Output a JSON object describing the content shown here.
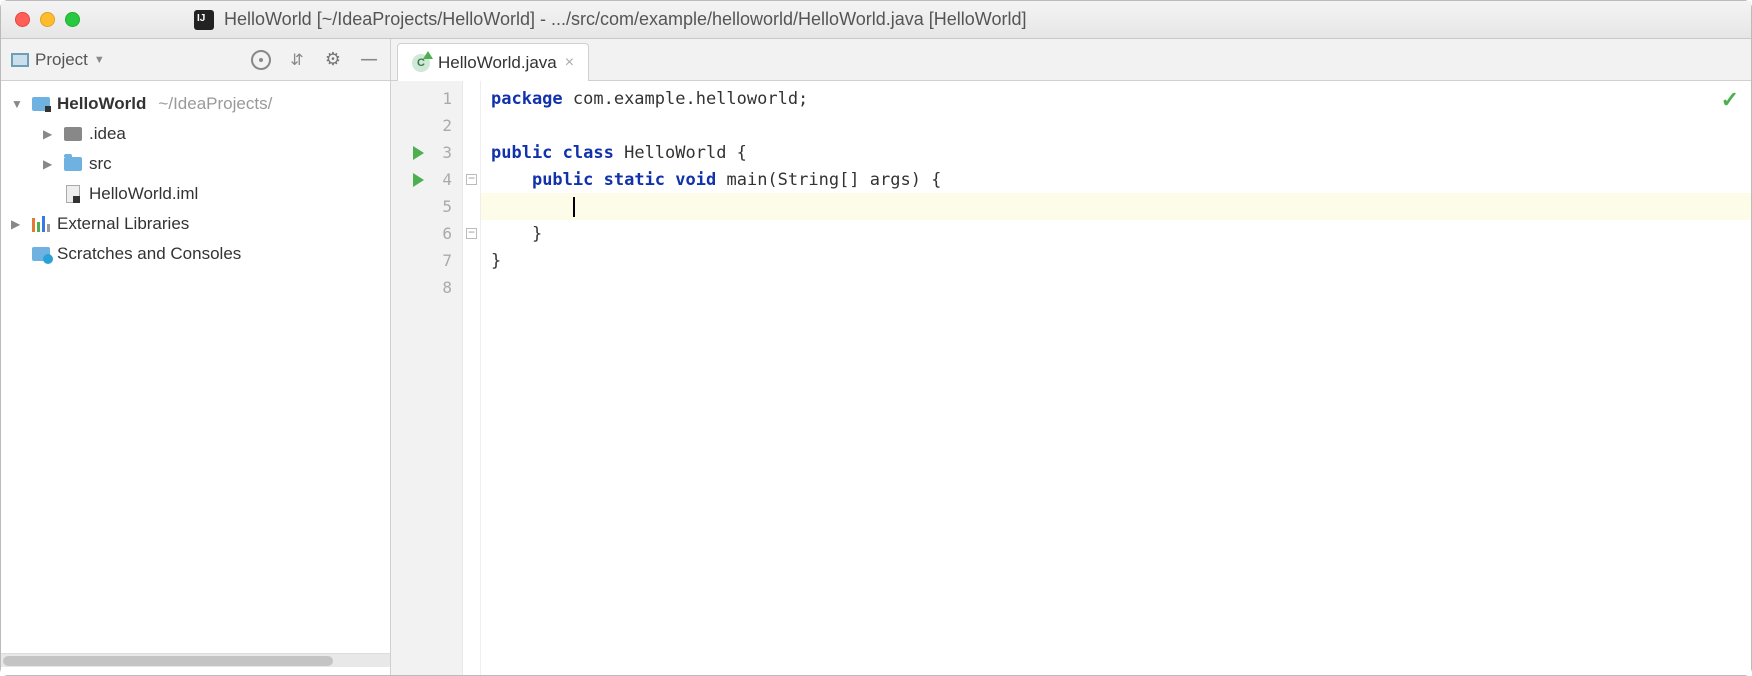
{
  "window": {
    "title": "HelloWorld [~/IdeaProjects/HelloWorld] - .../src/com/example/helloworld/HelloWorld.java [HelloWorld]"
  },
  "sidebar": {
    "tool_label": "Project",
    "tree": {
      "root": {
        "label": "HelloWorld",
        "sublabel": "~/IdeaProjects/"
      },
      "idea": {
        "label": ".idea"
      },
      "src": {
        "label": "src"
      },
      "iml": {
        "label": "HelloWorld.iml"
      },
      "ext": {
        "label": "External Libraries"
      },
      "scratch": {
        "label": "Scratches and Consoles"
      }
    }
  },
  "tabs": {
    "file": "HelloWorld.java"
  },
  "editor": {
    "gutter": [
      "1",
      "2",
      "3",
      "4",
      "5",
      "6",
      "7",
      "8"
    ],
    "code": {
      "l1a": "package",
      "l1b": " com.example.helloworld;",
      "l3a": "public",
      "l3b": " ",
      "l3c": "class",
      "l3d": " HelloWorld {",
      "l4a": "    ",
      "l4b": "public",
      "l4c": " ",
      "l4d": "static",
      "l4e": " ",
      "l4f": "void",
      "l4g": " main(String[] args) {",
      "l5a": "        ",
      "l6a": "    }",
      "l7a": "}"
    }
  }
}
